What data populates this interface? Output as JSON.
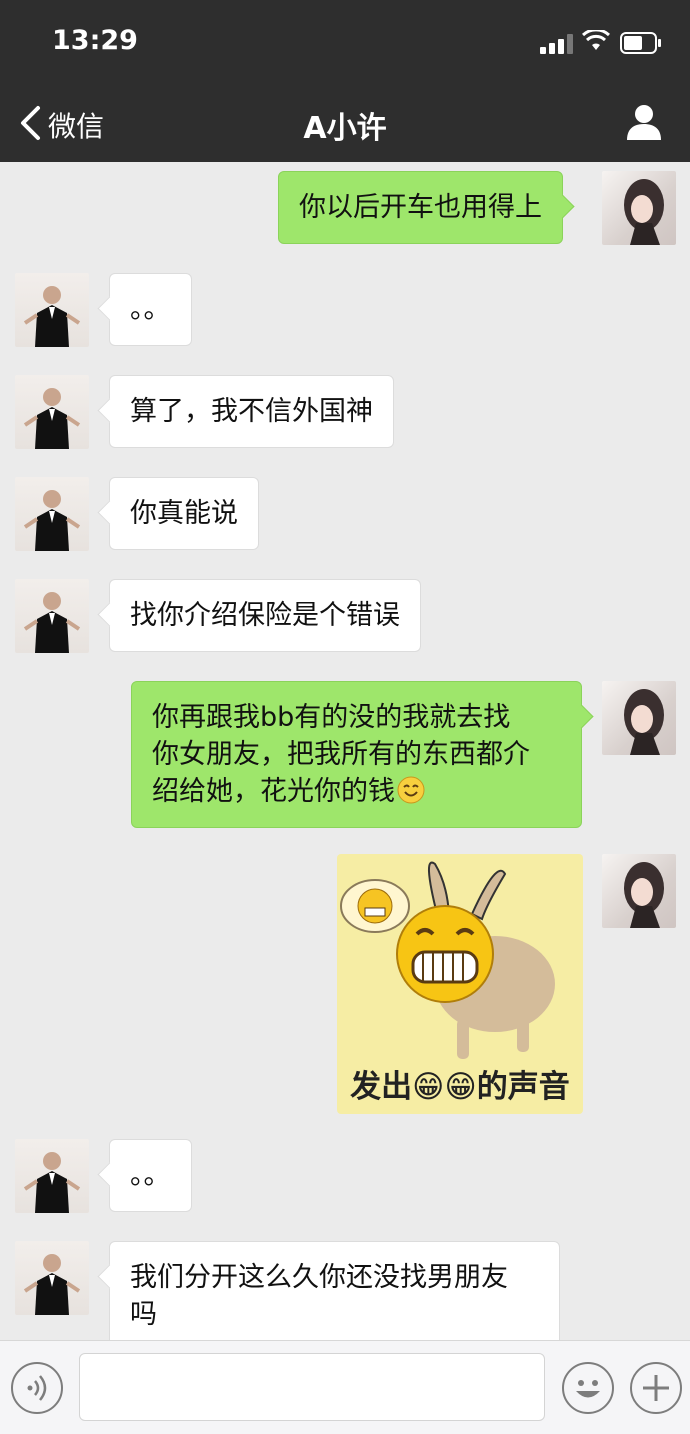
{
  "status_bar": {
    "time": "13:29"
  },
  "nav": {
    "back_label": "微信",
    "title": "A小许"
  },
  "messages": [
    {
      "side": "right",
      "text": "你以后开车也用得上"
    },
    {
      "side": "left",
      "text": "。。"
    },
    {
      "side": "left",
      "text": "算了，我不信外国神"
    },
    {
      "side": "left",
      "text": "你真能说"
    },
    {
      "side": "left",
      "text": "找你介绍保险是个错误"
    },
    {
      "side": "right",
      "text": "你再跟我bb有的没的我就去找\n你女朋友，把我所有的东西都介\n绍给她，花光你的钱"
    },
    {
      "side": "right",
      "type": "sticker",
      "caption": "发出😁😁的声音"
    },
    {
      "side": "left",
      "text": "。。"
    },
    {
      "side": "left",
      "text": "我们分开这么久你还没找男朋友\n吗"
    }
  ],
  "input_bar": {
    "value": ""
  },
  "colors": {
    "header": "#2e2e2e",
    "chat_bg": "#ebebeb",
    "own_bubble": "#9ee66b",
    "other_bubble": "#ffffff"
  },
  "icons": [
    "back-chevron-icon",
    "profile-icon",
    "signal-icon",
    "wifi-icon",
    "battery-icon",
    "voice-icon",
    "emoji-icon",
    "plus-icon",
    "smile-icon"
  ]
}
